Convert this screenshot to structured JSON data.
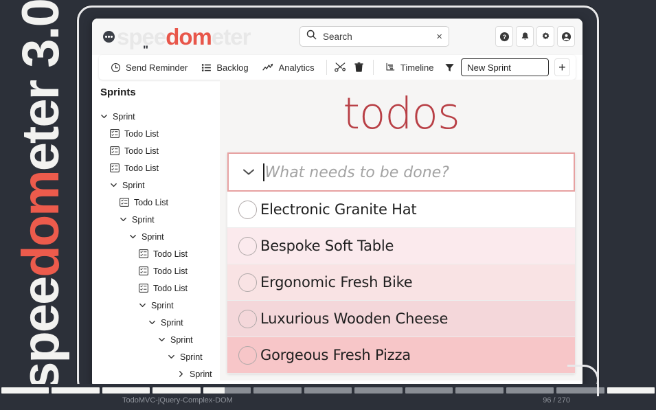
{
  "brand": {
    "vertical_prefix": "spee",
    "vertical_accent": "dom",
    "vertical_suffix": "eter 3.0",
    "header_prefix": "spee",
    "header_accent": "dom",
    "header_suffix": "eter",
    "quote_mark": "\"",
    "dots_icon": "chat-dots-icon"
  },
  "search": {
    "placeholder": "Search",
    "value": "Search",
    "icon": "search-icon",
    "clear_icon": "close-icon",
    "clear_label": "×"
  },
  "header_actions": [
    {
      "name": "help-button",
      "icon": "help-circle-icon"
    },
    {
      "name": "notifications-button",
      "icon": "bell-icon"
    },
    {
      "name": "settings-button",
      "icon": "gear-icon"
    },
    {
      "name": "account-button",
      "icon": "user-circle-icon"
    }
  ],
  "toolbar": {
    "send_reminder": "Send Reminder",
    "send_reminder_icon": "clock-icon",
    "backlog": "Backlog",
    "backlog_icon": "list-icon",
    "analytics": "Analytics",
    "analytics_icon": "chart-line-icon",
    "cut_icon": "scissors-icon",
    "delete_icon": "trash-icon",
    "timeline": "Timeline",
    "timeline_icon": "timeline-icon",
    "filter_icon": "filter-icon",
    "new_sprint_value": "New Sprint",
    "new_sprint_placeholder": "New Sprint",
    "add_label": "+",
    "add_icon": "plus-icon"
  },
  "sidebar": {
    "title": "Sprints",
    "items": [
      {
        "label": "Sprint",
        "type": "sprint",
        "depth": 0,
        "expanded": true
      },
      {
        "label": "Todo List",
        "type": "todo",
        "depth": 1
      },
      {
        "label": "Todo List",
        "type": "todo",
        "depth": 1
      },
      {
        "label": "Todo List",
        "type": "todo",
        "depth": 1
      },
      {
        "label": "Sprint",
        "type": "sprint",
        "depth": 1,
        "expanded": true
      },
      {
        "label": "Todo List",
        "type": "todo",
        "depth": 2
      },
      {
        "label": "Sprint",
        "type": "sprint",
        "depth": 2,
        "expanded": true
      },
      {
        "label": "Sprint",
        "type": "sprint",
        "depth": 3,
        "expanded": true
      },
      {
        "label": "Todo List",
        "type": "todo",
        "depth": 4
      },
      {
        "label": "Todo List",
        "type": "todo",
        "depth": 4
      },
      {
        "label": "Todo List",
        "type": "todo",
        "depth": 4
      },
      {
        "label": "Sprint",
        "type": "sprint",
        "depth": 4,
        "expanded": true
      },
      {
        "label": "Sprint",
        "type": "sprint",
        "depth": 5,
        "expanded": true
      },
      {
        "label": "Sprint",
        "type": "sprint",
        "depth": 6,
        "expanded": true
      },
      {
        "label": "Sprint",
        "type": "sprint",
        "depth": 7,
        "expanded": true
      },
      {
        "label": "Sprint",
        "type": "sprint",
        "depth": 8,
        "expanded": false
      }
    ]
  },
  "todos": {
    "title": "todos",
    "new_placeholder": "What needs to be done?",
    "new_value": "",
    "toggle_all_icon": "chevron-down-icon",
    "items": [
      {
        "label": "Electronic Granite Hat",
        "done": false,
        "shade": "#ffffff"
      },
      {
        "label": "Bespoke Soft Table",
        "done": false,
        "shade": "#fbeaed"
      },
      {
        "label": "Ergonomic Fresh Bike",
        "done": false,
        "shade": "#f9e3e4"
      },
      {
        "label": "Luxurious Wooden Cheese",
        "done": false,
        "shade": "#f4d7da"
      },
      {
        "label": "Gorgeous Fresh Pizza",
        "done": false,
        "shade": "#f7c6c8"
      }
    ]
  },
  "status_bar": {
    "benchmark_label": "TodoMVC-jQuery-Complex-DOM",
    "progress_text": "96 / 270",
    "segments": [
      100,
      100,
      100,
      100,
      45,
      0,
      0,
      0,
      0,
      0,
      0,
      0,
      100
    ]
  },
  "colors": {
    "accent_red": "#b83f45",
    "brand_red": "#ec5b4c",
    "window_chrome": "#2c3039",
    "frame_outline": "#e8e8ea"
  }
}
